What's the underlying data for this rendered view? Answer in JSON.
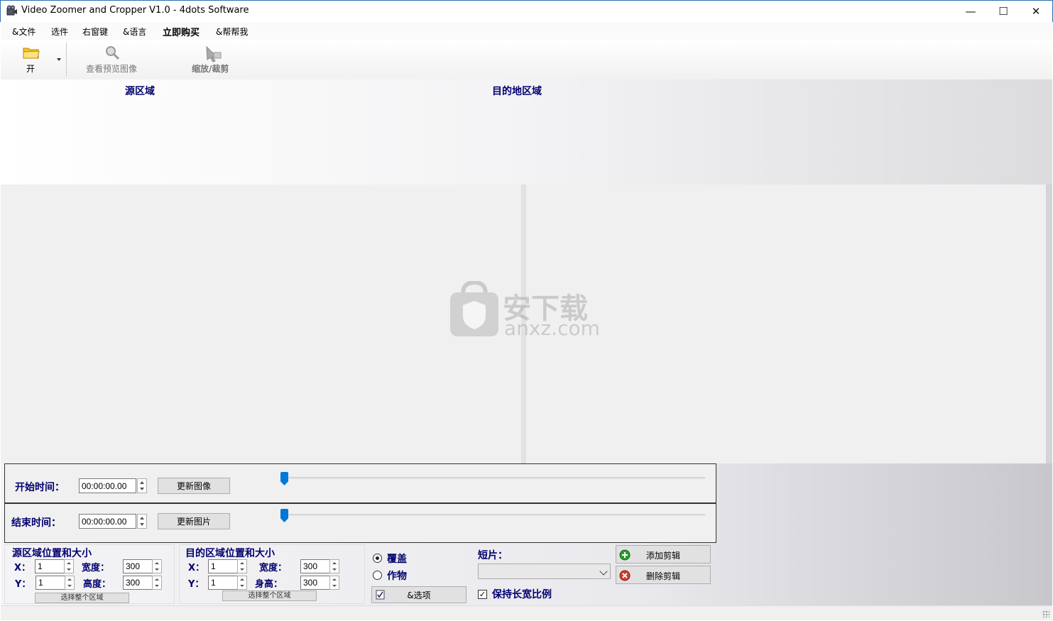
{
  "window": {
    "title": "Video Zoomer and Cropper V1.0 - 4dots Software",
    "minimize": "—",
    "maximize": "☐",
    "close": "✕"
  },
  "menu": {
    "file": "&文件",
    "options": "选件",
    "context": "右窗键",
    "language": "&语言",
    "buy": "立即购买",
    "help": "&帮帮我"
  },
  "toolbar": {
    "open": "开",
    "preview": "查看预览图像",
    "zoom_crop": "缩放/裁剪"
  },
  "areas": {
    "source": "源区域",
    "destination": "目的地区域"
  },
  "start_time": {
    "label": "开始时间：",
    "value": "00:00:00.00",
    "button": "更新图像",
    "slider_fraction": 0
  },
  "end_time": {
    "label": "结束时间：",
    "value": "00:00:00.00",
    "button": "更新图片",
    "slider_fraction": 0
  },
  "source_group": {
    "title": "源区域位置和大小",
    "x_label": "X：",
    "x_value": "1",
    "y_label": "Y：",
    "y_value": "1",
    "width_label": "宽度：",
    "width_value": "300",
    "height_label": "高度：",
    "height_value": "300",
    "select_all": "选择整个区域"
  },
  "dest_group": {
    "title": "目的区域位置和大小",
    "x_label": "X：",
    "x_value": "1",
    "y_label": "Y：",
    "y_value": "1",
    "width_label": "宽度：",
    "width_value": "300",
    "height_label": "身高：",
    "height_value": "300",
    "select_all": "选择整个区域"
  },
  "mode": {
    "overlay": "覆盖",
    "crop": "作物",
    "overlay_selected": true,
    "options_button": "&选项"
  },
  "clips": {
    "label": "短片：",
    "selected": "",
    "keep_ratio": "保持长宽比例",
    "keep_ratio_checked": true,
    "add": "添加剪辑",
    "delete": "删除剪辑"
  },
  "watermark": {
    "cn": "安下载",
    "en": "anxz.com"
  },
  "colors": {
    "label_blue": "#00006e",
    "slider_blue": "#0078d7",
    "add_green": "#2e9b2e",
    "delete_red": "#d83b2b"
  }
}
